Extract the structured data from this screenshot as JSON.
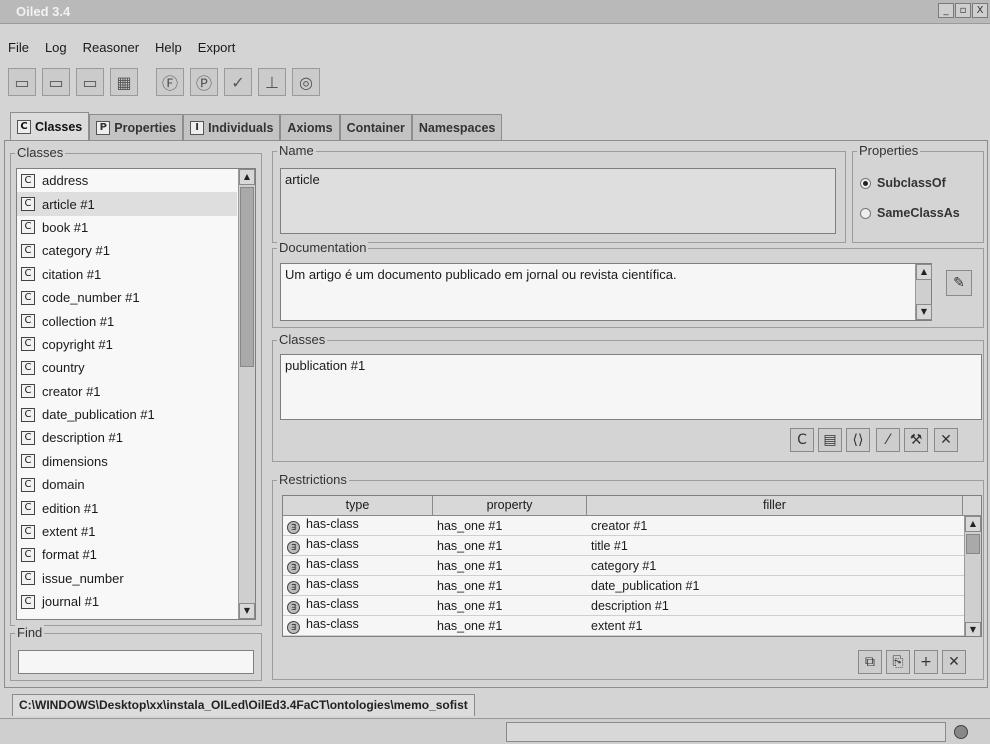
{
  "window": {
    "title": "Oiled 3.4",
    "controls": [
      "_",
      "▫",
      "X"
    ]
  },
  "menu": [
    "File",
    "Log",
    "Reasoner",
    "Help",
    "Export"
  ],
  "toolbar": [
    {
      "icon": "open-folder-icon",
      "glyph": "▭"
    },
    {
      "icon": "save-icon",
      "glyph": "▭"
    },
    {
      "icon": "print-icon",
      "glyph": "▭"
    },
    {
      "icon": "disk-icon",
      "glyph": "▦"
    },
    {
      "icon": "f-circle-icon",
      "glyph": "Ⓕ"
    },
    {
      "icon": "p-circle-icon",
      "glyph": "Ⓟ"
    },
    {
      "icon": "check-icon",
      "glyph": "✓"
    },
    {
      "icon": "hierarchy-icon",
      "glyph": "⊥"
    },
    {
      "icon": "globe-icon",
      "glyph": "◎"
    }
  ],
  "tabs": [
    {
      "label": "Classes",
      "icon": "C",
      "active": true
    },
    {
      "label": "Properties",
      "icon": "P"
    },
    {
      "label": "Individuals",
      "icon": "I"
    },
    {
      "label": "Axioms"
    },
    {
      "label": "Container"
    },
    {
      "label": "Namespaces"
    }
  ],
  "classes_panel": {
    "title": "Classes",
    "items": [
      "address",
      "article #1",
      "book #1",
      "category #1",
      "citation #1",
      "code_number #1",
      "collection #1",
      "copyright #1",
      "country",
      "creator #1",
      "date_publication #1",
      "description #1",
      "dimensions",
      "domain",
      "edition #1",
      "extent #1",
      "format #1",
      "issue_number",
      "journal #1"
    ],
    "selected_index": 1,
    "item_icon": "C",
    "find_label": "Find",
    "find_value": ""
  },
  "name_panel": {
    "title": "Name",
    "value": "article"
  },
  "properties_panel": {
    "title": "Properties",
    "options": [
      "SubclassOf",
      "SameClassAs"
    ],
    "selected": "SubclassOf"
  },
  "documentation_panel": {
    "title": "Documentation",
    "text": "Um artigo é um documento publicado em jornal ou revista científica."
  },
  "superclasses_panel": {
    "title": "Classes",
    "items": [
      "publication #1"
    ]
  },
  "restrictions_panel": {
    "title": "Restrictions",
    "columns": [
      "type",
      "property",
      "filler"
    ],
    "rows": [
      {
        "type": "has-class",
        "property": "has_one #1",
        "filler": "creator #1"
      },
      {
        "type": "has-class",
        "property": "has_one #1",
        "filler": "title #1"
      },
      {
        "type": "has-class",
        "property": "has_one #1",
        "filler": "category #1"
      },
      {
        "type": "has-class",
        "property": "has_one #1",
        "filler": "date_publication #1"
      },
      {
        "type": "has-class",
        "property": "has_one #1",
        "filler": "description #1"
      },
      {
        "type": "has-class",
        "property": "has_one #1",
        "filler": "extent #1"
      }
    ]
  },
  "file_path": "C:\\WINDOWS\\Desktop\\xx\\instala_OILed\\OilEd3.4FaCT\\ontologies\\memo_sofist"
}
